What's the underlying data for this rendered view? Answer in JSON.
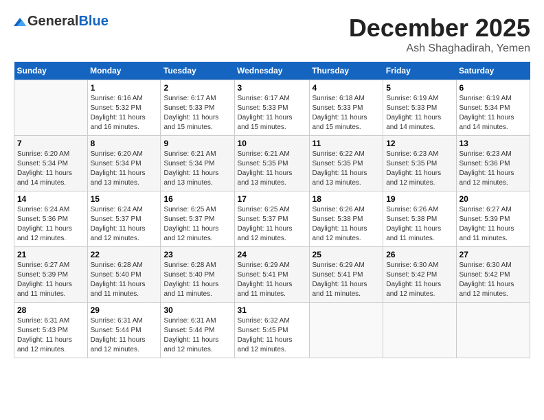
{
  "logo": {
    "general": "General",
    "blue": "Blue"
  },
  "title": "December 2025",
  "location": "Ash Shaghadirah, Yemen",
  "days_header": [
    "Sunday",
    "Monday",
    "Tuesday",
    "Wednesday",
    "Thursday",
    "Friday",
    "Saturday"
  ],
  "weeks": [
    [
      {
        "day": "",
        "info": ""
      },
      {
        "day": "1",
        "info": "Sunrise: 6:16 AM\nSunset: 5:32 PM\nDaylight: 11 hours\nand 16 minutes."
      },
      {
        "day": "2",
        "info": "Sunrise: 6:17 AM\nSunset: 5:33 PM\nDaylight: 11 hours\nand 15 minutes."
      },
      {
        "day": "3",
        "info": "Sunrise: 6:17 AM\nSunset: 5:33 PM\nDaylight: 11 hours\nand 15 minutes."
      },
      {
        "day": "4",
        "info": "Sunrise: 6:18 AM\nSunset: 5:33 PM\nDaylight: 11 hours\nand 15 minutes."
      },
      {
        "day": "5",
        "info": "Sunrise: 6:19 AM\nSunset: 5:33 PM\nDaylight: 11 hours\nand 14 minutes."
      },
      {
        "day": "6",
        "info": "Sunrise: 6:19 AM\nSunset: 5:34 PM\nDaylight: 11 hours\nand 14 minutes."
      }
    ],
    [
      {
        "day": "7",
        "info": "Sunrise: 6:20 AM\nSunset: 5:34 PM\nDaylight: 11 hours\nand 14 minutes."
      },
      {
        "day": "8",
        "info": "Sunrise: 6:20 AM\nSunset: 5:34 PM\nDaylight: 11 hours\nand 13 minutes."
      },
      {
        "day": "9",
        "info": "Sunrise: 6:21 AM\nSunset: 5:34 PM\nDaylight: 11 hours\nand 13 minutes."
      },
      {
        "day": "10",
        "info": "Sunrise: 6:21 AM\nSunset: 5:35 PM\nDaylight: 11 hours\nand 13 minutes."
      },
      {
        "day": "11",
        "info": "Sunrise: 6:22 AM\nSunset: 5:35 PM\nDaylight: 11 hours\nand 13 minutes."
      },
      {
        "day": "12",
        "info": "Sunrise: 6:23 AM\nSunset: 5:35 PM\nDaylight: 11 hours\nand 12 minutes."
      },
      {
        "day": "13",
        "info": "Sunrise: 6:23 AM\nSunset: 5:36 PM\nDaylight: 11 hours\nand 12 minutes."
      }
    ],
    [
      {
        "day": "14",
        "info": "Sunrise: 6:24 AM\nSunset: 5:36 PM\nDaylight: 11 hours\nand 12 minutes."
      },
      {
        "day": "15",
        "info": "Sunrise: 6:24 AM\nSunset: 5:37 PM\nDaylight: 11 hours\nand 12 minutes."
      },
      {
        "day": "16",
        "info": "Sunrise: 6:25 AM\nSunset: 5:37 PM\nDaylight: 11 hours\nand 12 minutes."
      },
      {
        "day": "17",
        "info": "Sunrise: 6:25 AM\nSunset: 5:37 PM\nDaylight: 11 hours\nand 12 minutes."
      },
      {
        "day": "18",
        "info": "Sunrise: 6:26 AM\nSunset: 5:38 PM\nDaylight: 11 hours\nand 12 minutes."
      },
      {
        "day": "19",
        "info": "Sunrise: 6:26 AM\nSunset: 5:38 PM\nDaylight: 11 hours\nand 11 minutes."
      },
      {
        "day": "20",
        "info": "Sunrise: 6:27 AM\nSunset: 5:39 PM\nDaylight: 11 hours\nand 11 minutes."
      }
    ],
    [
      {
        "day": "21",
        "info": "Sunrise: 6:27 AM\nSunset: 5:39 PM\nDaylight: 11 hours\nand 11 minutes."
      },
      {
        "day": "22",
        "info": "Sunrise: 6:28 AM\nSunset: 5:40 PM\nDaylight: 11 hours\nand 11 minutes."
      },
      {
        "day": "23",
        "info": "Sunrise: 6:28 AM\nSunset: 5:40 PM\nDaylight: 11 hours\nand 11 minutes."
      },
      {
        "day": "24",
        "info": "Sunrise: 6:29 AM\nSunset: 5:41 PM\nDaylight: 11 hours\nand 11 minutes."
      },
      {
        "day": "25",
        "info": "Sunrise: 6:29 AM\nSunset: 5:41 PM\nDaylight: 11 hours\nand 11 minutes."
      },
      {
        "day": "26",
        "info": "Sunrise: 6:30 AM\nSunset: 5:42 PM\nDaylight: 11 hours\nand 12 minutes."
      },
      {
        "day": "27",
        "info": "Sunrise: 6:30 AM\nSunset: 5:42 PM\nDaylight: 11 hours\nand 12 minutes."
      }
    ],
    [
      {
        "day": "28",
        "info": "Sunrise: 6:31 AM\nSunset: 5:43 PM\nDaylight: 11 hours\nand 12 minutes."
      },
      {
        "day": "29",
        "info": "Sunrise: 6:31 AM\nSunset: 5:44 PM\nDaylight: 11 hours\nand 12 minutes."
      },
      {
        "day": "30",
        "info": "Sunrise: 6:31 AM\nSunset: 5:44 PM\nDaylight: 11 hours\nand 12 minutes."
      },
      {
        "day": "31",
        "info": "Sunrise: 6:32 AM\nSunset: 5:45 PM\nDaylight: 11 hours\nand 12 minutes."
      },
      {
        "day": "",
        "info": ""
      },
      {
        "day": "",
        "info": ""
      },
      {
        "day": "",
        "info": ""
      }
    ]
  ]
}
